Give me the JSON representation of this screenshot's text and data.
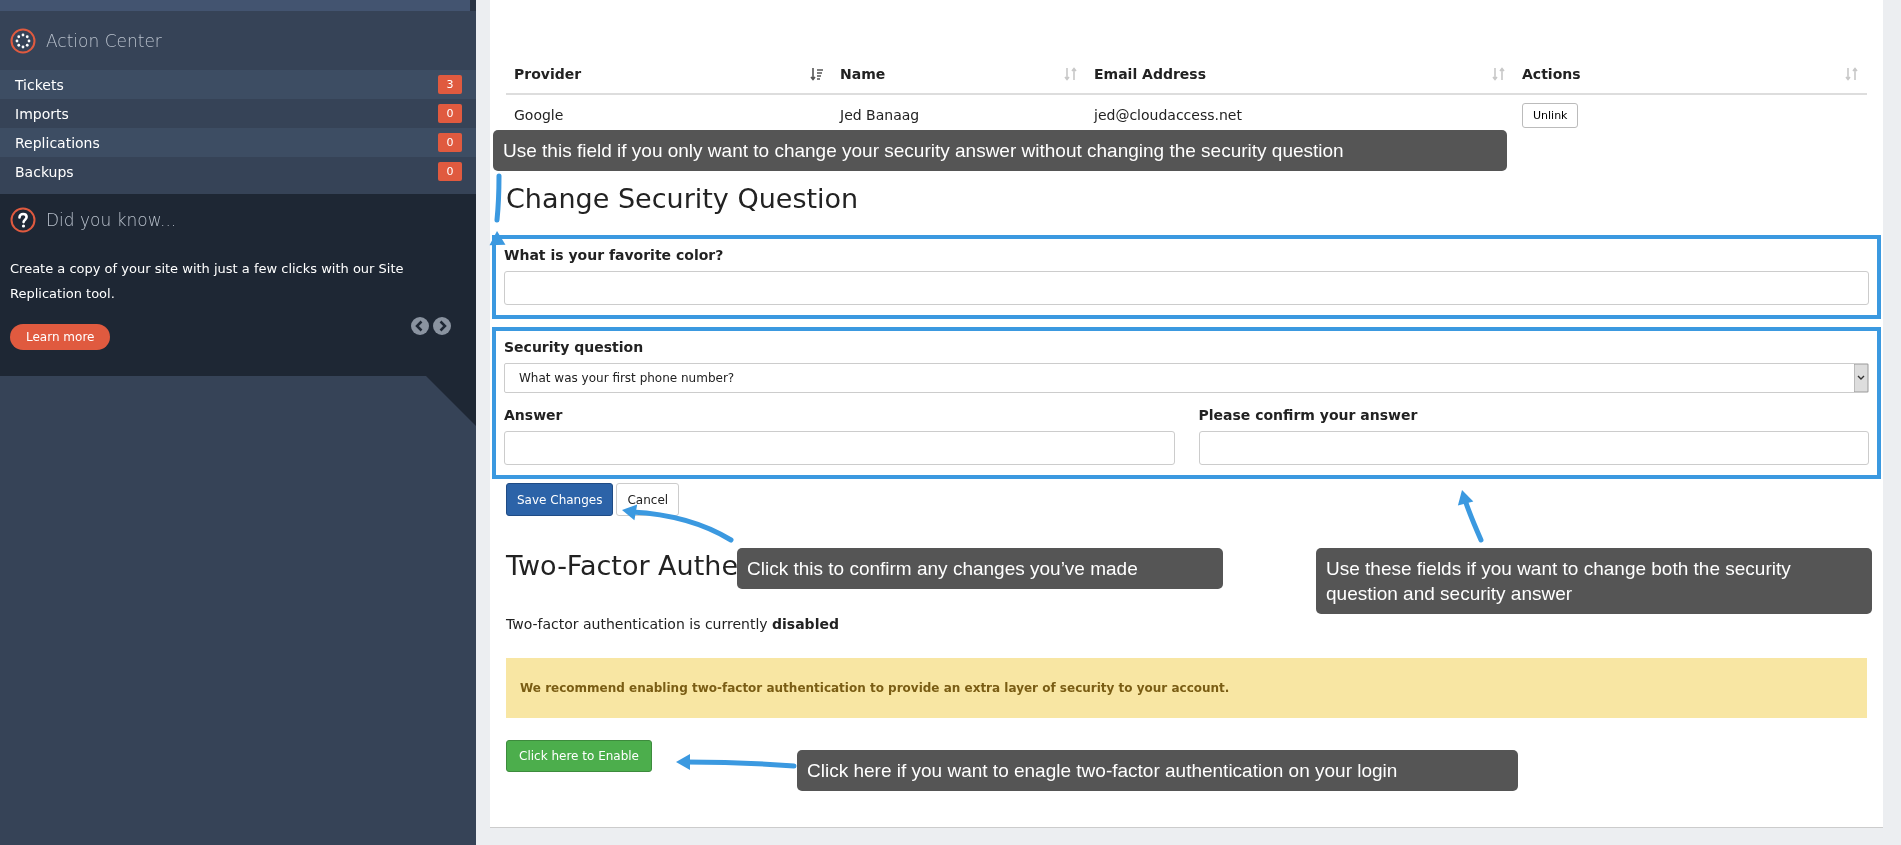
{
  "sidebar": {
    "action_center": {
      "title": "Action Center",
      "items": [
        {
          "label": "Tickets",
          "count": "3"
        },
        {
          "label": "Imports",
          "count": "0"
        },
        {
          "label": "Replications",
          "count": "0"
        },
        {
          "label": "Backups",
          "count": "0"
        }
      ]
    },
    "did_you_know": {
      "title": "Did you know...",
      "text": "Create a copy of your site with just a few clicks with our Site Replication tool.",
      "button": "Learn more"
    }
  },
  "linked_accounts": {
    "columns": [
      {
        "label": "Provider",
        "sorted": true
      },
      {
        "label": "Name",
        "sorted": false
      },
      {
        "label": "Email Address",
        "sorted": false
      },
      {
        "label": "Actions",
        "sorted": false
      }
    ],
    "rows": [
      {
        "cells": [
          "Google",
          "Jed Banaag",
          "jed@cloudaccess.net"
        ],
        "action": "Unlink"
      }
    ]
  },
  "security_question": {
    "heading": "Change Security Question",
    "answer_only": {
      "label": "What is your favorite color?"
    },
    "question": {
      "label": "Security question",
      "value": "What was your first phone number?"
    },
    "answer": {
      "label": "Answer"
    },
    "confirm": {
      "label": "Please confirm your answer"
    },
    "buttons": [
      {
        "label": "Save Changes",
        "kind": "primary"
      },
      {
        "label": "Cancel",
        "kind": "default"
      }
    ]
  },
  "two_factor": {
    "heading": "Two-Factor Authe",
    "status": "Two-factor authentication is currently **disabled**",
    "alert": "We recommend enabling two-factor authentication to provide an extra layer of security to your account.",
    "button": "Click here to Enable"
  },
  "annotations": [
    {
      "text": "Use this field if you only want to change your security answer without changing the security question"
    },
    {
      "text": "Click this to confirm any changes you’ve made"
    },
    {
      "text": "Use these fields if you want to change both the security question and security answer"
    },
    {
      "text": "Click here if you want to enagle two-factor authentication on your login"
    }
  ]
}
